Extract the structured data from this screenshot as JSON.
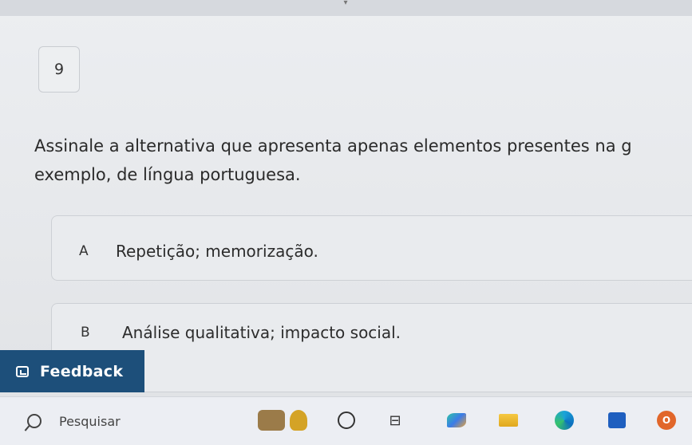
{
  "question": {
    "number": "9",
    "line1": "Assinale a alternativa que apresenta apenas elementos presentes na g",
    "line2": "exemplo, de língua portuguesa."
  },
  "options": [
    {
      "letter": "A",
      "text": "Repetição; memorização."
    },
    {
      "letter": "B",
      "text": "Análise qualitativa; impacto social."
    }
  ],
  "feedback": {
    "label": "Feedback",
    "icon": "feedback-icon"
  },
  "taskbar": {
    "search_placeholder": "Pesquisar",
    "icons": [
      "search-icon",
      "taskbar-art-icon",
      "task-view-icon",
      "widgets-icon",
      "copilot-icon",
      "file-explorer-icon",
      "edge-icon",
      "store-icon",
      "office-icon"
    ]
  },
  "colors": {
    "feedback_bg": "#1d4f7a",
    "text": "#2a2a2a"
  }
}
